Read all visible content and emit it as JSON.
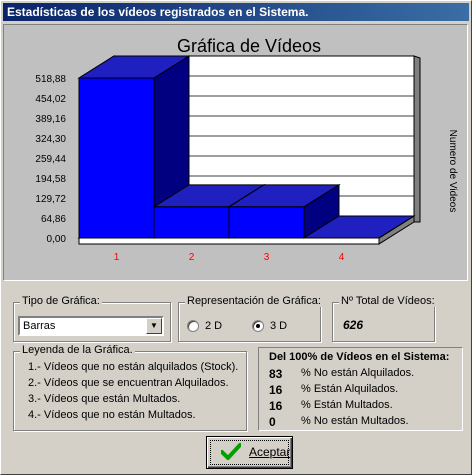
{
  "window": {
    "title": "Estadísticas de los vídeos registrados en el Sistema."
  },
  "chart_data": {
    "type": "bar",
    "title": "Gráfica de Vídeos",
    "ylabel": "Numero de Videos",
    "xlabel": "",
    "categories": [
      "1",
      "2",
      "3",
      "4"
    ],
    "values": [
      518.88,
      101,
      101,
      0
    ],
    "yticks": [
      "518,88",
      "454,02",
      "389,16",
      "324,30",
      "259,44",
      "194,58",
      "129,72",
      "64,86",
      "0,00"
    ],
    "ylim": [
      0,
      518.88
    ],
    "grid": true,
    "bar_color": "#0000ff",
    "category_label_color": "#ff0000"
  },
  "tipo_grafica": {
    "title": "Tipo de Gráfica:",
    "selected": "Barras"
  },
  "representacion": {
    "title": "Representación de Gráfica:",
    "options": [
      "2 D",
      "3 D"
    ],
    "selected": "3 D"
  },
  "total": {
    "title": "Nº Total de Vídeos:",
    "value": "626"
  },
  "leyenda": {
    "title": "Leyenda de la Gráfica.",
    "items": [
      "1.- Vídeos que no están alquilados (Stock).",
      "2.- Vídeos que se encuentran Alquilados.",
      "3.- Vídeos que están Multados.",
      "4.- Vídeos que no están Multados."
    ]
  },
  "porcentajes": {
    "title": "Del 100% de Vídeos en el Sistema:",
    "rows": [
      {
        "value": "83",
        "text": "% No están Alquilados."
      },
      {
        "value": "16",
        "text": "% Están Alquilados."
      },
      {
        "value": "16",
        "text": "% Están Multados."
      },
      {
        "value": "0",
        "text": "% No están Multados."
      }
    ]
  },
  "accept_button": {
    "label": "Aceptar"
  },
  "colors": {
    "title_bar_start": "#0a246a",
    "title_bar_end": "#3a6ea5",
    "bar_front": "#0000ff",
    "bar_top": "#2020c0",
    "bar_side": "#000080",
    "accept_check": "#00a000"
  }
}
